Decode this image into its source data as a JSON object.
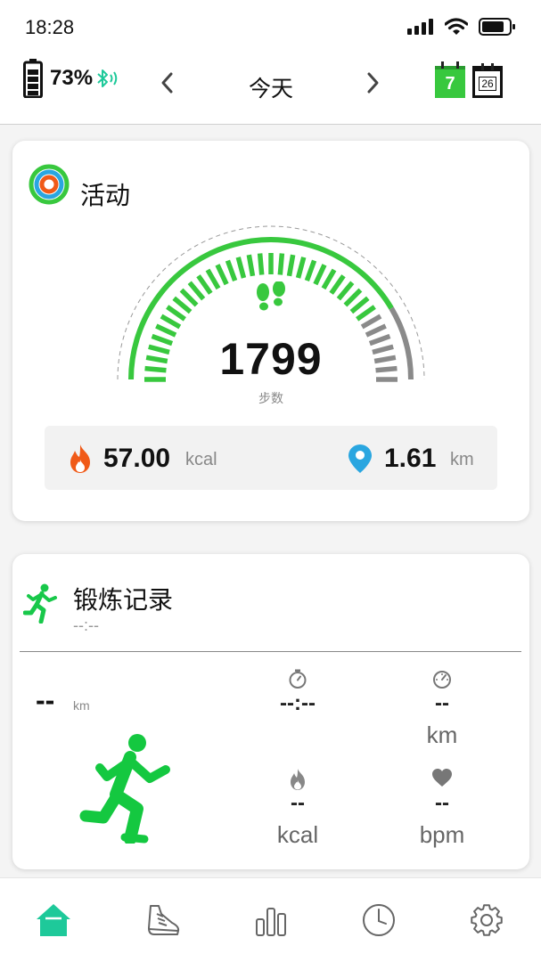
{
  "status_bar": {
    "time": "18:28"
  },
  "header": {
    "battery_percent": "73%",
    "date_label": "今天",
    "calendar_week_day": "7",
    "calendar_month_day": "26"
  },
  "activity": {
    "title": "活动",
    "steps": "1799",
    "steps_label": "步数",
    "goal_progress": 0.83,
    "calories_value": "57.00",
    "calories_unit": "kcal",
    "distance_value": "1.61",
    "distance_unit": "km"
  },
  "exercise": {
    "title": "锻炼记录",
    "time": "--:--",
    "distance_value": "--",
    "distance_unit": "km",
    "duration_value": "--:--",
    "pace_value": "--",
    "pace_unit": "km",
    "calories_value": "--",
    "calories_unit": "kcal",
    "heart_value": "--",
    "heart_unit": "bpm"
  },
  "colors": {
    "accent_green": "#38c83e",
    "home_teal": "#1ec99a",
    "fire_orange": "#f05a18",
    "pin_blue": "#2aa6e0",
    "gauge_gray": "#8a8a8a"
  },
  "tabs": [
    {
      "icon": "home-icon",
      "active": true
    },
    {
      "icon": "shoe-icon",
      "active": false
    },
    {
      "icon": "bar-chart-icon",
      "active": false
    },
    {
      "icon": "clock-icon",
      "active": false
    },
    {
      "icon": "gear-icon",
      "active": false
    }
  ]
}
